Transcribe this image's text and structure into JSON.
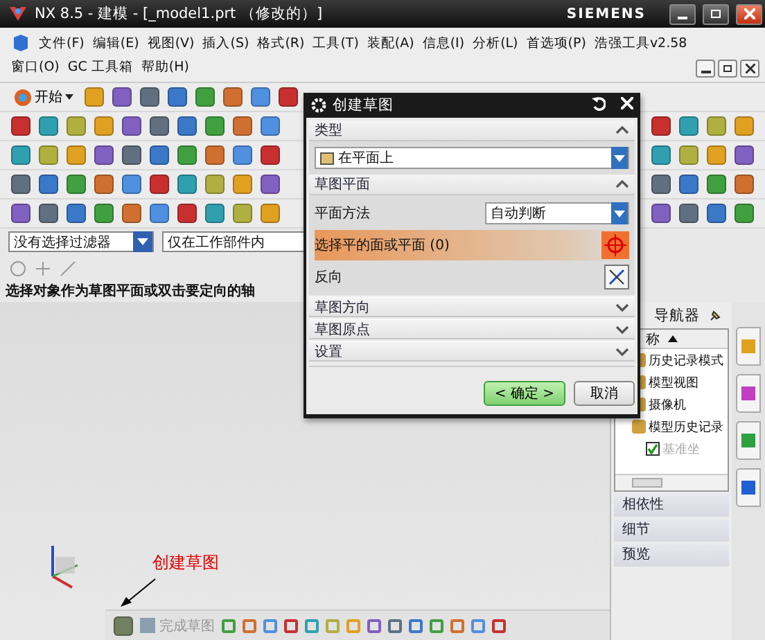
{
  "window": {
    "title": "NX 8.5 - 建模 - [_model1.prt （修改的）]",
    "brand": "SIEMENS"
  },
  "menu": [
    "文件(F)",
    "编辑(E)",
    "视图(V)",
    "插入(S)",
    "格式(R)",
    "工具(T)",
    "装配(A)",
    "信息(I)",
    "分析(L)",
    "首选项(P)",
    "浩强工具v2.58",
    "窗口(O)",
    "GC 工具箱",
    "帮助(H)"
  ],
  "toolbar": {
    "start": "开始"
  },
  "filters": {
    "type_filter": "没有选择过滤器",
    "scope": "仅在工作部件内"
  },
  "status_prompt": "选择对象作为草图平面或双击要定向的轴",
  "dialog": {
    "title": "创建草图",
    "sections": [
      {
        "kind": "type",
        "label": "类型",
        "expanded": true,
        "value": "在平面上"
      },
      {
        "kind": "plane",
        "label": "草图平面",
        "expanded": true,
        "method_label": "平面方法",
        "method_value": "自动判断",
        "select_label": "选择平的面或平面 (0)",
        "reverse_label": "反向"
      },
      {
        "kind": "plain",
        "label": "草图方向",
        "expanded": false
      },
      {
        "kind": "plain",
        "label": "草图原点",
        "expanded": false
      },
      {
        "kind": "plain",
        "label": "设置",
        "expanded": false
      }
    ],
    "ok": "< 确定 >",
    "cancel": "取消"
  },
  "navigator": {
    "title": "导航器",
    "column": "称",
    "items": [
      {
        "label": "历史记录模式"
      },
      {
        "label": "模型视图"
      },
      {
        "label": "摄像机"
      },
      {
        "label": "模型历史记录",
        "children": [
          {
            "label": "基准坐",
            "checked": true
          }
        ]
      }
    ],
    "panels": [
      "相依性",
      "细节",
      "预览"
    ]
  },
  "sketch_toolbar": {
    "finish": "完成草图"
  },
  "annotation": "创建草图"
}
